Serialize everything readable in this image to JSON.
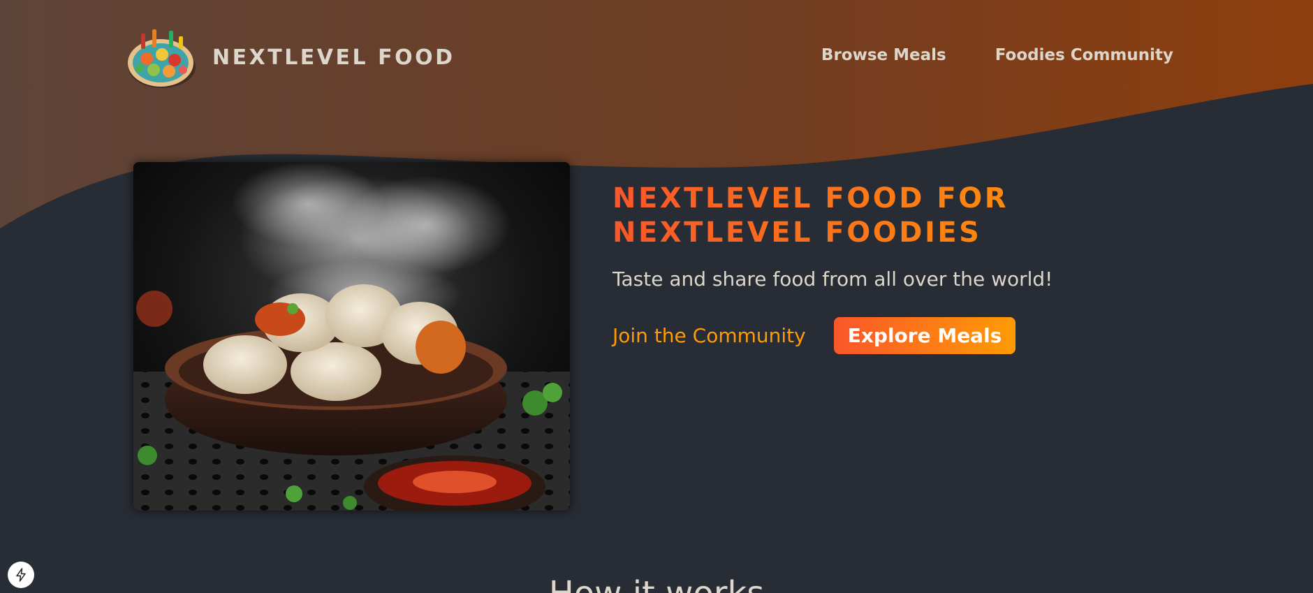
{
  "header": {
    "logo_text": "NEXTLEVEL FOOD",
    "logo_alt": "A plate with food on it",
    "nav": [
      {
        "label": "Browse Meals"
      },
      {
        "label": "Foodies Community"
      }
    ]
  },
  "hero": {
    "image_alt": "Steaming dumplings in a bowl",
    "title_line1": "NEXTLEVEL FOOD FOR",
    "title_line2": "NEXTLEVEL FOODIES",
    "subtitle": "Taste and share food from all over the world!",
    "join_link": "Join the Community",
    "explore_button": "Explore Meals"
  },
  "section": {
    "heading": "How it works"
  },
  "colors": {
    "background": "#282c34",
    "header_gradient_start": "#5e4438",
    "header_gradient_end": "#8e3e10",
    "accent_start": "#f9572a",
    "accent_end": "#ff9b05",
    "text": "#ddd6cb"
  },
  "icons": {
    "dev_indicator": "lightning-bolt-icon"
  }
}
